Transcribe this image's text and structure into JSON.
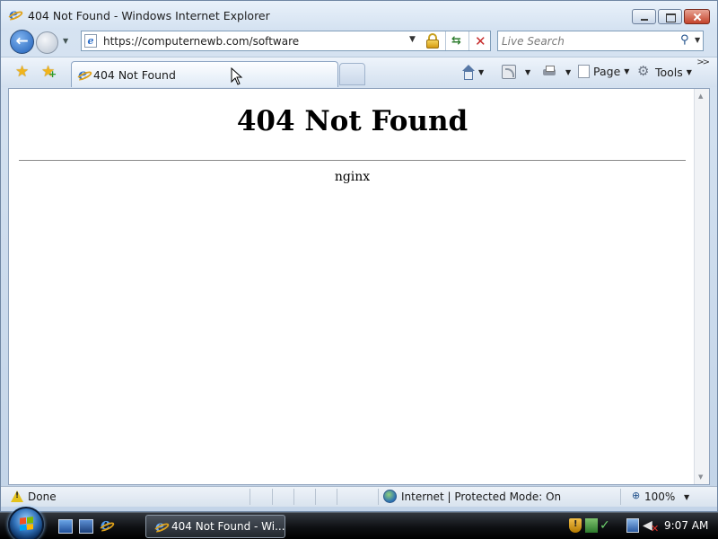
{
  "window": {
    "title": "404 Not Found - Windows Internet Explorer"
  },
  "address_bar": {
    "url": "https://computernewb.com/software",
    "search_placeholder": "Live Search"
  },
  "tabs": [
    {
      "label": "404 Not Found"
    }
  ],
  "commands": {
    "page_label": "Page",
    "tools_label": "Tools",
    "more_label": ">>"
  },
  "page": {
    "heading": "404 Not Found",
    "server": "nginx"
  },
  "status_bar": {
    "text": "Done",
    "zone": "Internet | Protected Mode: On",
    "zoom": "100%"
  },
  "taskbar": {
    "active_window": "404 Not Found - Wi...",
    "clock": "9:07 AM"
  },
  "colors": {
    "titlebar": "#d4e2f1",
    "taskbar": "#0e1013",
    "accent_blue": "#1f5fb8",
    "stop_red": "#c62a2a"
  },
  "icons": [
    "ie-icon",
    "back-arrow-icon",
    "forward-arrow-icon",
    "lock-icon",
    "refresh-icon",
    "stop-icon",
    "search-icon",
    "favorites-star-icon",
    "add-favorites-icon",
    "home-icon",
    "feeds-icon",
    "print-icon",
    "page-icon",
    "tools-gear-icon",
    "warning-icon",
    "globe-icon",
    "zoom-icon",
    "windows-start-icon",
    "show-desktop-icon",
    "switch-windows-icon",
    "shield-warning-icon",
    "network-icon",
    "volume-muted-icon"
  ]
}
